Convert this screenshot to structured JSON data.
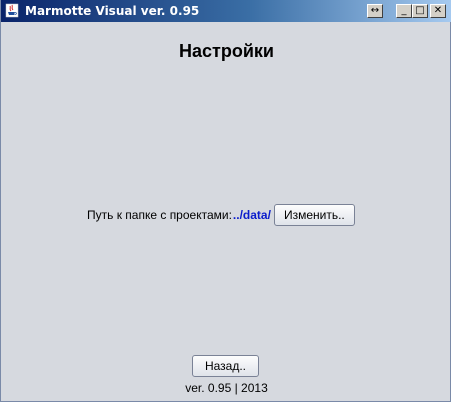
{
  "window": {
    "title": "Marmotte Visual ver. 0.95",
    "controls": {
      "resize_glyph": "↔",
      "minimize_glyph": "_",
      "maximize_glyph": "□",
      "close_glyph": "✕"
    }
  },
  "settings": {
    "heading": "Настройки",
    "path_label": "Путь к папке с проектами:",
    "path_value": "../data/",
    "change_button": "Изменить.."
  },
  "actions": {
    "back_button": "Назад.."
  },
  "footer": {
    "version_text": "ver. 0.95 | 2013"
  },
  "colors": {
    "background": "#d6d9df",
    "titlebar_start": "#0a246a",
    "titlebar_end": "#a6caf0",
    "path_value": "#0a1ccc"
  }
}
